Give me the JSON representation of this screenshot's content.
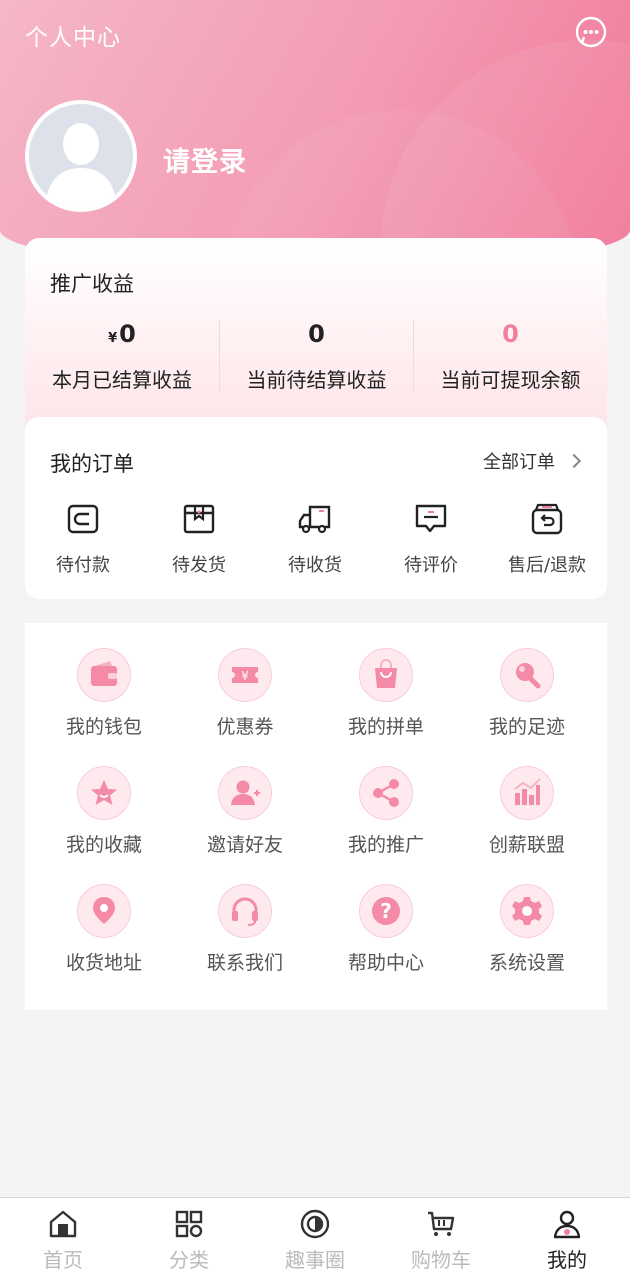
{
  "header": {
    "title": "个人中心",
    "login_text": "请登录"
  },
  "earnings": {
    "title": "推广收益",
    "currency": "¥",
    "items": [
      {
        "value": "0",
        "label": "本月已结算收益"
      },
      {
        "value": "0",
        "label": "当前待结算收益"
      },
      {
        "value": "0",
        "label": "当前可提现余额"
      }
    ]
  },
  "orders": {
    "title": "我的订单",
    "all_label": "全部订单",
    "items": [
      {
        "label": "待付款",
        "icon": "wallet-icon"
      },
      {
        "label": "待发货",
        "icon": "box-icon"
      },
      {
        "label": "待收货",
        "icon": "truck-icon"
      },
      {
        "label": "待评价",
        "icon": "comment-icon"
      },
      {
        "label": "售后/退款",
        "icon": "refund-icon"
      }
    ]
  },
  "services": [
    {
      "label": "我的钱包",
      "icon": "wallet-icon"
    },
    {
      "label": "优惠券",
      "icon": "coupon-icon"
    },
    {
      "label": "我的拼单",
      "icon": "shopping-bag-icon"
    },
    {
      "label": "我的足迹",
      "icon": "footprint-icon"
    },
    {
      "label": "我的收藏",
      "icon": "star-icon"
    },
    {
      "label": "邀请好友",
      "icon": "invite-user-icon"
    },
    {
      "label": "我的推广",
      "icon": "share-icon"
    },
    {
      "label": "创薪联盟",
      "icon": "bar-chart-icon"
    },
    {
      "label": "收货地址",
      "icon": "location-icon"
    },
    {
      "label": "联系我们",
      "icon": "headset-icon"
    },
    {
      "label": "帮助中心",
      "icon": "help-icon"
    },
    {
      "label": "系统设置",
      "icon": "settings-icon"
    }
  ],
  "tabbar": [
    {
      "label": "首页",
      "icon": "home-icon",
      "active": false
    },
    {
      "label": "分类",
      "icon": "grid-icon",
      "active": false
    },
    {
      "label": "趣事圈",
      "icon": "circle-icon",
      "active": false
    },
    {
      "label": "购物车",
      "icon": "cart-icon",
      "active": false
    },
    {
      "label": "我的",
      "icon": "user-icon",
      "active": true
    }
  ],
  "colors": {
    "accent": "#f07f9a",
    "header_start": "#f5b7c8",
    "header_end": "#f07596"
  }
}
